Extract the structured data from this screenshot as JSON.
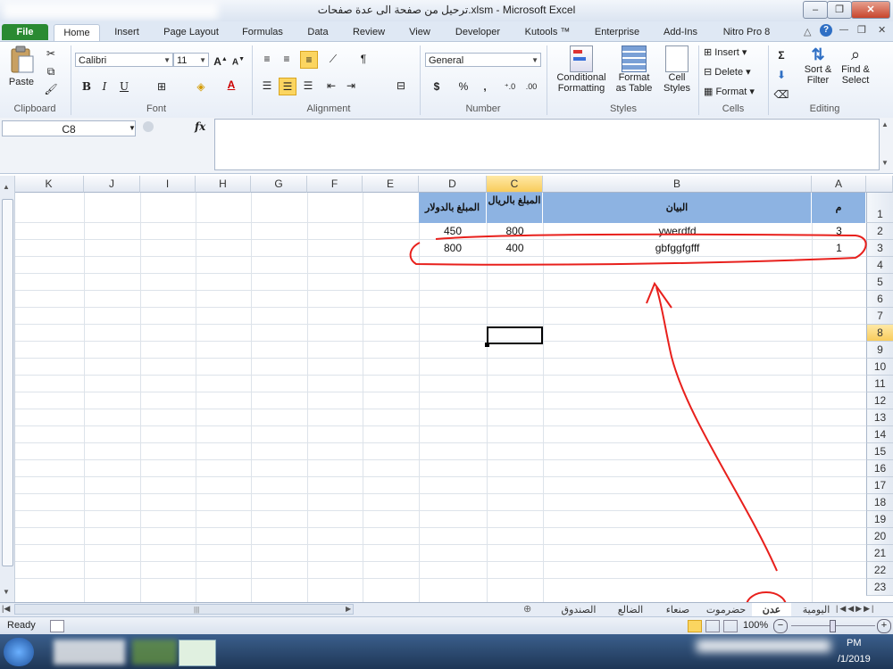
{
  "window": {
    "title": "ترحيل من صفحة الى عدة صفحات.xlsm  -  Microsoft Excel",
    "minimize_glyph": "–",
    "restore_glyph": "❐",
    "close_glyph": "✕"
  },
  "ribbon_tabs": [
    "File",
    "Home",
    "Insert",
    "Page Layout",
    "Formulas",
    "Data",
    "Review",
    "View",
    "Developer",
    "Kutools ™",
    "Enterprise",
    "Add-Ins",
    "Nitro Pro 8"
  ],
  "ribbon": {
    "clipboard": {
      "paste": "Paste",
      "label": "Clipboard"
    },
    "font": {
      "name": "Calibri",
      "size": "11",
      "bold": "B",
      "italic": "I",
      "underline": "U",
      "label": "Font"
    },
    "alignment": {
      "label": "Alignment"
    },
    "number": {
      "format": "General",
      "currency": "$",
      "percent": "%",
      "comma": ",",
      "label": "Number"
    },
    "styles": {
      "conditional": "Conditional",
      "conditional2": "Formatting",
      "format_table": "Format",
      "format_table2": "as Table",
      "cell_styles": "Cell",
      "cell_styles2": "Styles",
      "label": "Styles"
    },
    "cells": {
      "insert": "Insert",
      "delete": "Delete",
      "format": "Format",
      "label": "Cells"
    },
    "editing": {
      "sort": "Sort &",
      "sort2": "Filter",
      "find": "Find &",
      "find2": "Select",
      "label": "Editing"
    }
  },
  "formula_bar": {
    "name_box": "C8",
    "fx": "fx",
    "formula": ""
  },
  "grid": {
    "columns": [
      "K",
      "J",
      "I",
      "H",
      "G",
      "F",
      "E",
      "D",
      "C",
      "B",
      "A"
    ],
    "selected_column": "C",
    "rows": [
      "1",
      "2",
      "3",
      "4",
      "5",
      "6",
      "7",
      "8",
      "9",
      "10",
      "11",
      "12",
      "13",
      "14",
      "15",
      "16",
      "17",
      "18",
      "19",
      "20",
      "21",
      "22",
      "23"
    ],
    "selected_row": "8",
    "header": {
      "A": "م",
      "B": "البيان",
      "C": "المبلغ بالريال",
      "D": "المبلغ بالدولار"
    },
    "data_rows": [
      {
        "A": "3",
        "B": "ywerdfd",
        "C": "800",
        "D": "450"
      },
      {
        "A": "1",
        "B": "gbfggfgfff",
        "C": "400",
        "D": "800"
      }
    ]
  },
  "sheet_tabs": [
    "اليومية",
    "عدن",
    "حضرموت",
    "صنعاء",
    "الضالع",
    "الصندوق"
  ],
  "active_sheet": "عدن",
  "status": {
    "ready": "Ready",
    "zoom": "100%",
    "time": "PM",
    "date": "/1/2019"
  },
  "colors": {
    "header_fill": "#8db3e2",
    "annotation": "#e8201c",
    "file_tab": "#2a8a32"
  }
}
